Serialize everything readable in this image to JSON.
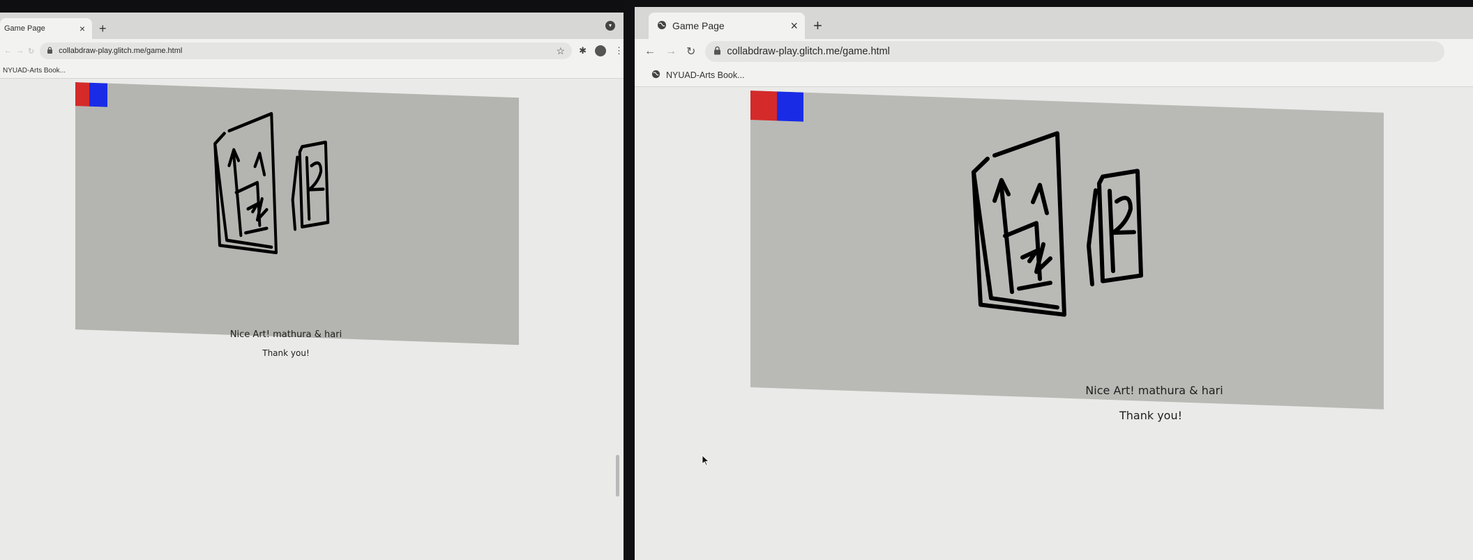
{
  "left_window": {
    "tab": {
      "title": "Game Page",
      "close": "×"
    },
    "new_tab": "+",
    "address": "collabdraw-play.glitch.me/game.html",
    "bookmark": "NYUAD-Arts Book...",
    "message": "Nice Art! mathura & hari",
    "thanks": "Thank you!"
  },
  "right_window": {
    "tab": {
      "title": "Game Page",
      "close": "×"
    },
    "new_tab": "+",
    "address": "collabdraw-play.glitch.me/game.html",
    "bookmark": "NYUAD-Arts Book...",
    "message": "Nice Art! mathura & hari",
    "thanks": "Thank you!"
  },
  "colors": {
    "red_swatch": "#d42a2a",
    "blue_swatch": "#1a2be6",
    "canvas": "#b4b5b0",
    "ink": "#000000"
  },
  "icons": [
    "globe-icon",
    "close-icon",
    "plus-icon",
    "back-icon",
    "forward-icon",
    "reload-icon",
    "lock-icon",
    "star-icon",
    "puzzle-icon",
    "profile-icon",
    "more-icon",
    "cursor-icon"
  ]
}
